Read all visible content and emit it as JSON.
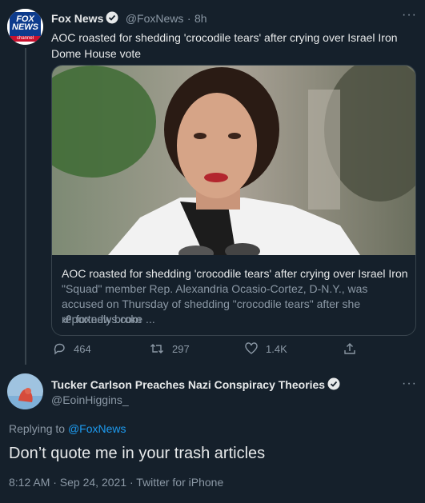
{
  "tweet1": {
    "author_name": "Fox News",
    "handle": "@FoxNews",
    "dot": "·",
    "time": "8h",
    "text": "AOC roasted for shedding 'crocodile tears' after crying over Israel Iron Dome House vote",
    "more_icon": "more-dots-icon",
    "avatar_text": [
      "FOX",
      "NEWS",
      "channel"
    ],
    "card": {
      "title": "AOC roasted for shedding 'crocodile tears' after crying over Israel Iron...",
      "description": "\"Squad\" member Rep. Alexandria Ocasio-Cortez, D-N.Y., was accused on Thursday of shedding \"crocodile tears\" after she reportedly broke ...",
      "domain": "foxnews.com"
    },
    "actions": {
      "replies": "464",
      "retweets": "297",
      "likes": "1.4K"
    }
  },
  "tweet2": {
    "author_name": "Tucker Carlson Preaches Nazi Conspiracy Theories",
    "handle": "@EoinHiggins_",
    "replying_prefix": "Replying to",
    "replying_to": "@FoxNews",
    "text": "Don’t quote me in your trash articles",
    "timestamp": "8:12 AM · Sep 24, 2021 · Twitter for iPhone"
  },
  "colors": {
    "background": "#15202b",
    "accent": "#1d9bf0",
    "muted": "#8b98a5",
    "border": "#38444d"
  }
}
